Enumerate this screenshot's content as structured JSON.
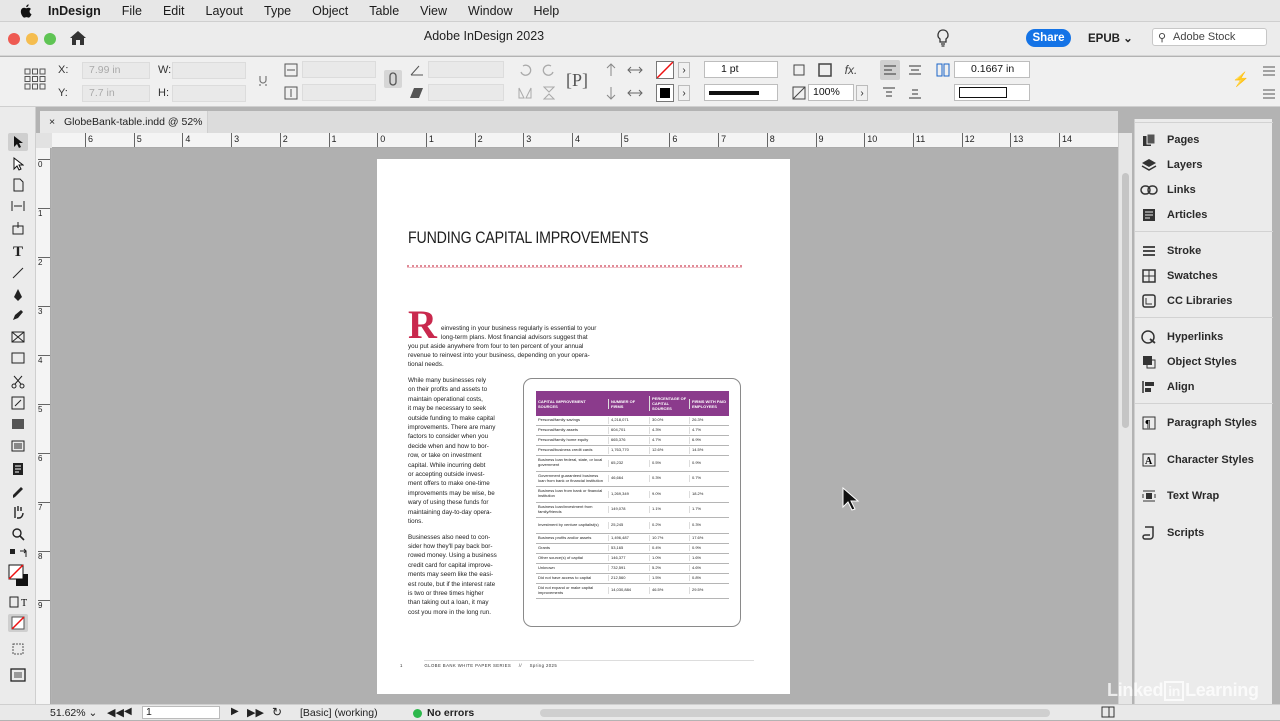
{
  "menubar": {
    "app": "InDesign",
    "items": [
      "File",
      "Edit",
      "Layout",
      "Type",
      "Object",
      "Table",
      "View",
      "Window",
      "Help"
    ]
  },
  "window": {
    "title": "Adobe InDesign 2023",
    "share": "Share",
    "export": "EPUB",
    "stock_placeholder": "Adobe Stock"
  },
  "controls": {
    "x_label": "X:",
    "x_value": "7.99 in",
    "y_label": "Y:",
    "y_value": "7.7 in",
    "w_label": "W:",
    "h_label": "H:",
    "stroke_weight": "1 pt",
    "opacity": "100%",
    "gutter": "0.1667 in"
  },
  "document_tab": {
    "label": "GlobeBank-table.indd @ 52%"
  },
  "ruler_ticks": [
    "6",
    "5",
    "4",
    "3",
    "2",
    "1",
    "0",
    "1",
    "2",
    "3",
    "4",
    "5",
    "6",
    "7",
    "8",
    "9",
    "10",
    "11",
    "12",
    "13",
    "14"
  ],
  "ruler_v_ticks": [
    "0",
    "1",
    "2",
    "3",
    "4",
    "5",
    "6",
    "7",
    "8",
    "9"
  ],
  "page": {
    "heading": "FUNDING CAPITAL IMPROVEMENTS",
    "dropcap": "R",
    "intro_lines": [
      "einvesting in your business regularly is essential to your",
      "long-term plans. Most financial advisors suggest that",
      "you put aside anywhere from four to ten percent of your annual",
      "revenue to reinvest into your business, depending on your opera-",
      "tional needs."
    ],
    "col_lines": [
      "While many businesses rely",
      "on their profits and assets to",
      "maintain operational costs,",
      "it may be necessary to seek",
      "outside funding to make capital",
      "improvements. There are many",
      "factors to consider when you",
      "decide when and how to bor-",
      "row, or take on investment",
      "capital. While incurring debt",
      "or accepting outside invest-",
      "ment offers to make one-time",
      "improvements may be wise, be",
      "wary of using these funds for",
      "maintaining day-to-day opera-",
      "tions.",
      "",
      "Businesses also need to con-",
      "sider how they'll pay back bor-",
      "rowed money. Using a business",
      "credit card for capital improve-",
      "ments may seem like the easi-",
      "est route, but if the interest rate",
      "is two or three times higher",
      "than taking out a loan, it may",
      "cost you more in the long run."
    ],
    "footer": {
      "page_num": "1",
      "series": "GLOBE BANK WHITE PAPER SERIES",
      "sep": "//",
      "season": "Spring 2025"
    }
  },
  "table": {
    "headers": [
      "CAPITAL IMPROVEMENT SOURCES",
      "NUMBER OF FIRMS",
      "PERCENTAGE OF CAPITAL SOURCES",
      "FIRMS WITH PAID EMPLOYEES"
    ],
    "rows": [
      [
        "Personal/family savings",
        "4,218,071",
        "30.0%",
        "26.3%"
      ],
      [
        "Personal/family assets",
        "604,701",
        "4.3%",
        "4.7%"
      ],
      [
        "Personal/family home equity",
        "665,376",
        "4.7%",
        "6.9%"
      ],
      [
        "Personal/business credit cards",
        "1,763,770",
        "12.6%",
        "14.5%"
      ],
      [
        "Business loan federal, state, or local government",
        "65,232",
        "0.5%",
        "0.9%"
      ],
      [
        "Government guaranteed business loan from bank or financial institution",
        "46,664",
        "0.3%",
        "0.7%"
      ],
      [
        "Business loan from bank or financial institution",
        "1,269,349",
        "9.0%",
        "18.2%"
      ],
      [
        "Business loan/investment from family/friends",
        "149,078",
        "1.1%",
        "1.7%"
      ],
      [
        "Investment by venture capitalist(s)",
        "25,245",
        "0.2%",
        "0.3%"
      ],
      [
        "Business profits and/or assets",
        "1,496,487",
        "10.7%",
        "17.6%"
      ],
      [
        "Grants",
        "53,165",
        "0.4%",
        "0.9%"
      ],
      [
        "Other source(s) of capital",
        "146,377",
        "1.0%",
        "1.6%"
      ],
      [
        "Unknown",
        "732,591",
        "5.2%",
        "4.6%"
      ],
      [
        "Did not have access to capital",
        "212,560",
        "1.5%",
        "0.8%"
      ],
      [
        "Did not expand or make capital improvements",
        "14,030,884",
        "46.5%",
        "29.5%"
      ]
    ]
  },
  "panel": {
    "items": [
      "Pages",
      "Layers",
      "Links",
      "Articles",
      "Stroke",
      "Swatches",
      "CC Libraries",
      "Hyperlinks",
      "Object Styles",
      "Align",
      "Paragraph Styles",
      "Character Styles",
      "Text Wrap",
      "Scripts"
    ]
  },
  "status": {
    "zoom": "51.62%",
    "page": "1",
    "style": "[Basic] (working)",
    "errors": "No errors"
  },
  "watermark": {
    "pre": "Linked",
    "box": "in",
    "post": "Learning"
  },
  "colors": {
    "accent": "#c9284d",
    "table_header": "#8b3b8c",
    "share": "#1473e6",
    "status_ok": "#2db84c"
  }
}
